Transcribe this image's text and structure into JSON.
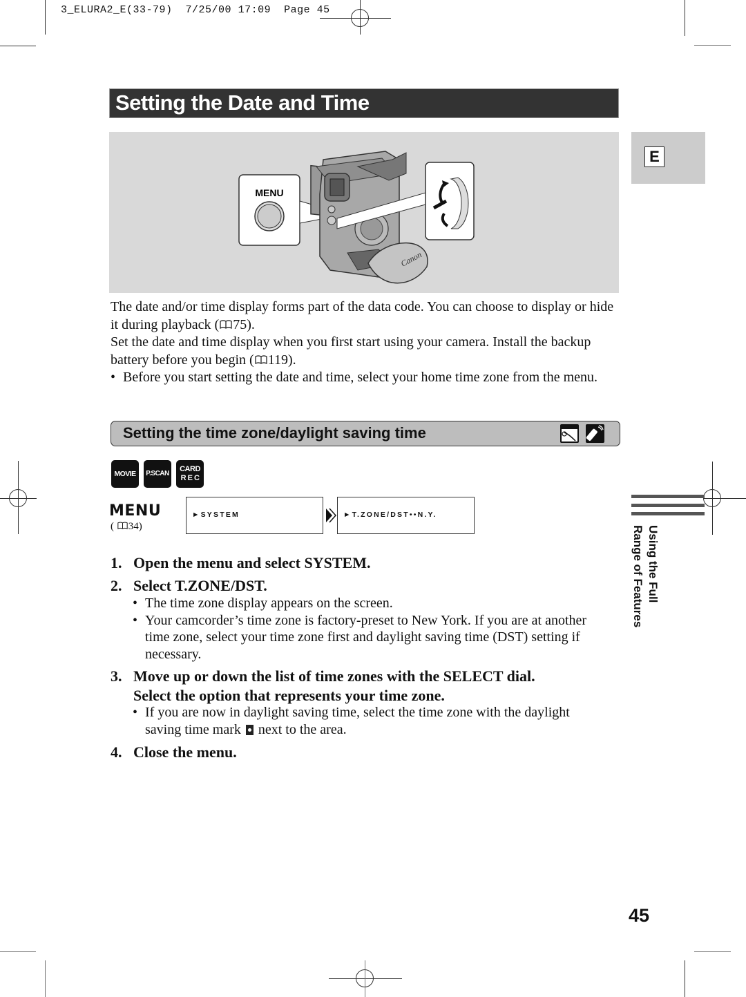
{
  "print_slug": {
    "file": "3_ELURA2_E(33-79)",
    "date": "7/25/00",
    "time": "17:09",
    "page_label": "Page 45"
  },
  "title": "Setting the Date and Time",
  "language_tab": "E",
  "illustration": {
    "menu_button_label": "MENU",
    "brand_on_strap": "Canon",
    "icons": [
      "camcorder-illustration",
      "menu-button-callout",
      "select-dial-callout"
    ]
  },
  "intro": {
    "p1_a": "The date and/or time display forms part of the data code. You can choose to display or hide it during playback (",
    "p1_ref": "75",
    "p1_b": ").",
    "p2_a": "Set the date and time display when you first start using your camera. Install the backup battery before you begin (",
    "p2_ref": "119",
    "p2_b": ").",
    "bullet": "Before you start setting the date and time, select your home time zone from the menu."
  },
  "section": {
    "title": "Setting the time zone/daylight saving time",
    "icons": [
      "camera-body-icon",
      "remote-control-icon"
    ]
  },
  "modes": [
    {
      "line1": "MOVIE",
      "line2": ""
    },
    {
      "line1": "P.SCAN",
      "line2": ""
    },
    {
      "line1": "CARD",
      "line2": "R E C"
    }
  ],
  "menu_nav": {
    "label": "MENU",
    "ref_open": "(",
    "ref_page": "34",
    "ref_close": ")",
    "box1": "►SYSTEM",
    "box2": "►T.ZONE/DST••N.Y."
  },
  "steps": [
    {
      "num": "1.",
      "text": "Open the menu and select SYSTEM."
    },
    {
      "num": "2.",
      "text": "Select T.ZONE/DST."
    },
    {
      "num": "3.",
      "text": "Move up or down the list of time zones with the SELECT dial.",
      "text2": "Select the option that represents your time zone."
    },
    {
      "num": "4.",
      "text": "Close the menu."
    }
  ],
  "step2_bullets": [
    "The time zone display appears on the screen.",
    "Your camcorder’s time zone is factory-preset to New York. If you are at another time zone, select your time zone first and daylight saving time (DST) setting if necessary."
  ],
  "step3_bullet": {
    "a": "If you are now in daylight saving time, select the time zone with the daylight saving time mark",
    "b": "next to the area."
  },
  "side_tab": {
    "line1": "Using the Full",
    "line2": "Range of Features"
  },
  "page_number": "45"
}
